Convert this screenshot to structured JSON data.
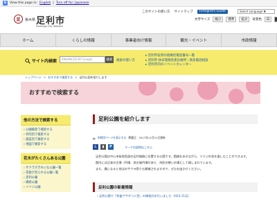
{
  "translate_bar": {
    "g": "G",
    "view_in": "View this page in:",
    "language": "English",
    "turn_off": "Turn off for: Japanese"
  },
  "header": {
    "logo_glyph": "足",
    "prefecture": "栃木県",
    "city": "足利市",
    "city_roman": "Ashikaga City Website",
    "links": [
      "このサイトの使い方",
      "サイトマップ",
      "Foreigners Guide"
    ],
    "language_select": "Select Language ▼",
    "access": {
      "font_label": "文字サイズ",
      "small": "縮小",
      "standard": "標準",
      "large": "拡大",
      "color_label": "背景色",
      "white": "白",
      "black": "黒"
    }
  },
  "gnav": [
    "ホーム",
    "くらしの情報",
    "事業者向け情報",
    "観光・イベント",
    "市政情報"
  ],
  "search": {
    "label": "サイト内検索",
    "placeholder": "ENHANCED BY Google",
    "button": "検索",
    "hint": "検索の使い方",
    "links": [
      "足利市役所の組織別電話番号一覧",
      "足利市 休日夜間急患診療所・救急電話相談",
      "足利市内のイベントカレンダー"
    ]
  },
  "breadcrumb": [
    "トップページ",
    "おすすめで検索する",
    "足利公園を紹介します"
  ],
  "hero": {
    "title": "おすすめで検索する"
  },
  "sidebar": {
    "sections": [
      {
        "heading": "他の方法で検索する",
        "links": [
          "公園検索で検索する",
          "目的別で検索する",
          "施設別で検索する",
          "地図で検索する"
        ]
      },
      {
        "heading": "花木がたくさんある公園",
        "links": [
          "サクラがきれいな公園一覧",
          "花桃が見られる公園一覧",
          "足利公園",
          "織姫公園",
          "ツツジ公園"
        ]
      }
    ]
  },
  "main": {
    "title": "足利公園を紹介します",
    "meta": {
      "print": "印刷用ページを表示する",
      "updated": "掲載日：2017年11月21日更新"
    },
    "icon_note": "マークの説明はこちら",
    "paragraphs": [
      "足利公園は中心市街地西部の足利城跡に位置する公園です。園路を歩きながら、ツツジの花を楽しむことができます。",
      "園内には日本の古墳（円墳、前方後円墳があり、市民の憩いの場として親しまれています。",
      "また、春になると地元のサクラ祭りも開催されますので、ぜひお出かけください。"
    ],
    "news_heading": "足利公園の新着情報",
    "news_items": [
      "足利公園で「秋盛アサギリ二世」の様相式を行いました（H24.11月）"
    ]
  }
}
